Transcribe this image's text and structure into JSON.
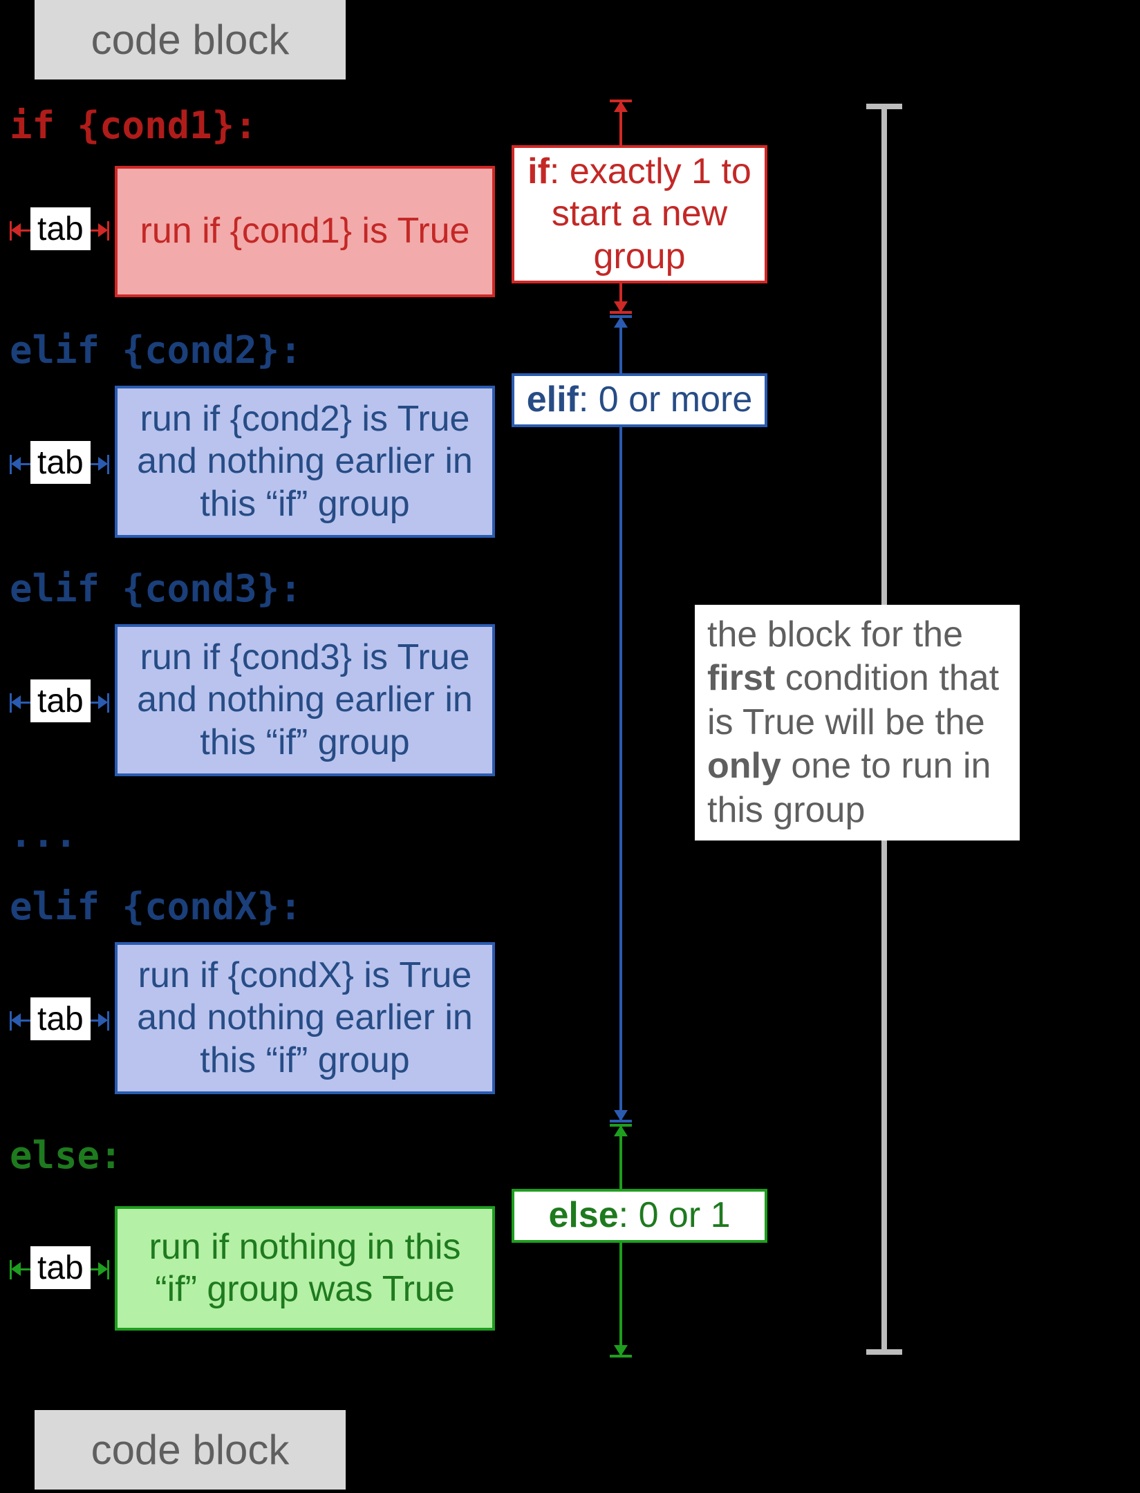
{
  "labels": {
    "code_block_top": "code block",
    "code_block_bottom": "code block",
    "tab": "tab",
    "ellipsis": "..."
  },
  "code": {
    "if": "if {cond1}:",
    "elif1": "elif {cond2}:",
    "elif2": "elif {cond3}:",
    "elifX": "elif {condX}:",
    "else": "else:"
  },
  "run": {
    "if": "run if {cond1} is True",
    "elif1": "run if {cond2} is True and nothing earlier in this “if” group",
    "elif2": "run if {cond3} is True and nothing earlier in this “if” group",
    "elifX": "run if {condX} is True and nothing earlier in this “if” group",
    "else": "run if nothing in this “if” group was True"
  },
  "annotations": {
    "if_kw": "if",
    "if_rest": ": exactly 1 to start a new group",
    "elif_kw": "elif",
    "elif_rest": ": 0 or more",
    "else_kw": "else",
    "else_rest": ": 0 or 1",
    "overall_1": "the block for the ",
    "overall_b1": "first",
    "overall_2": " condition that is True will be the ",
    "overall_b2": "only",
    "overall_3": " one to run in this group"
  },
  "colors": {
    "red": "#d02826",
    "blue": "#2a5bb0",
    "green": "#1e9e1e",
    "grey": "#bdbdbd"
  }
}
